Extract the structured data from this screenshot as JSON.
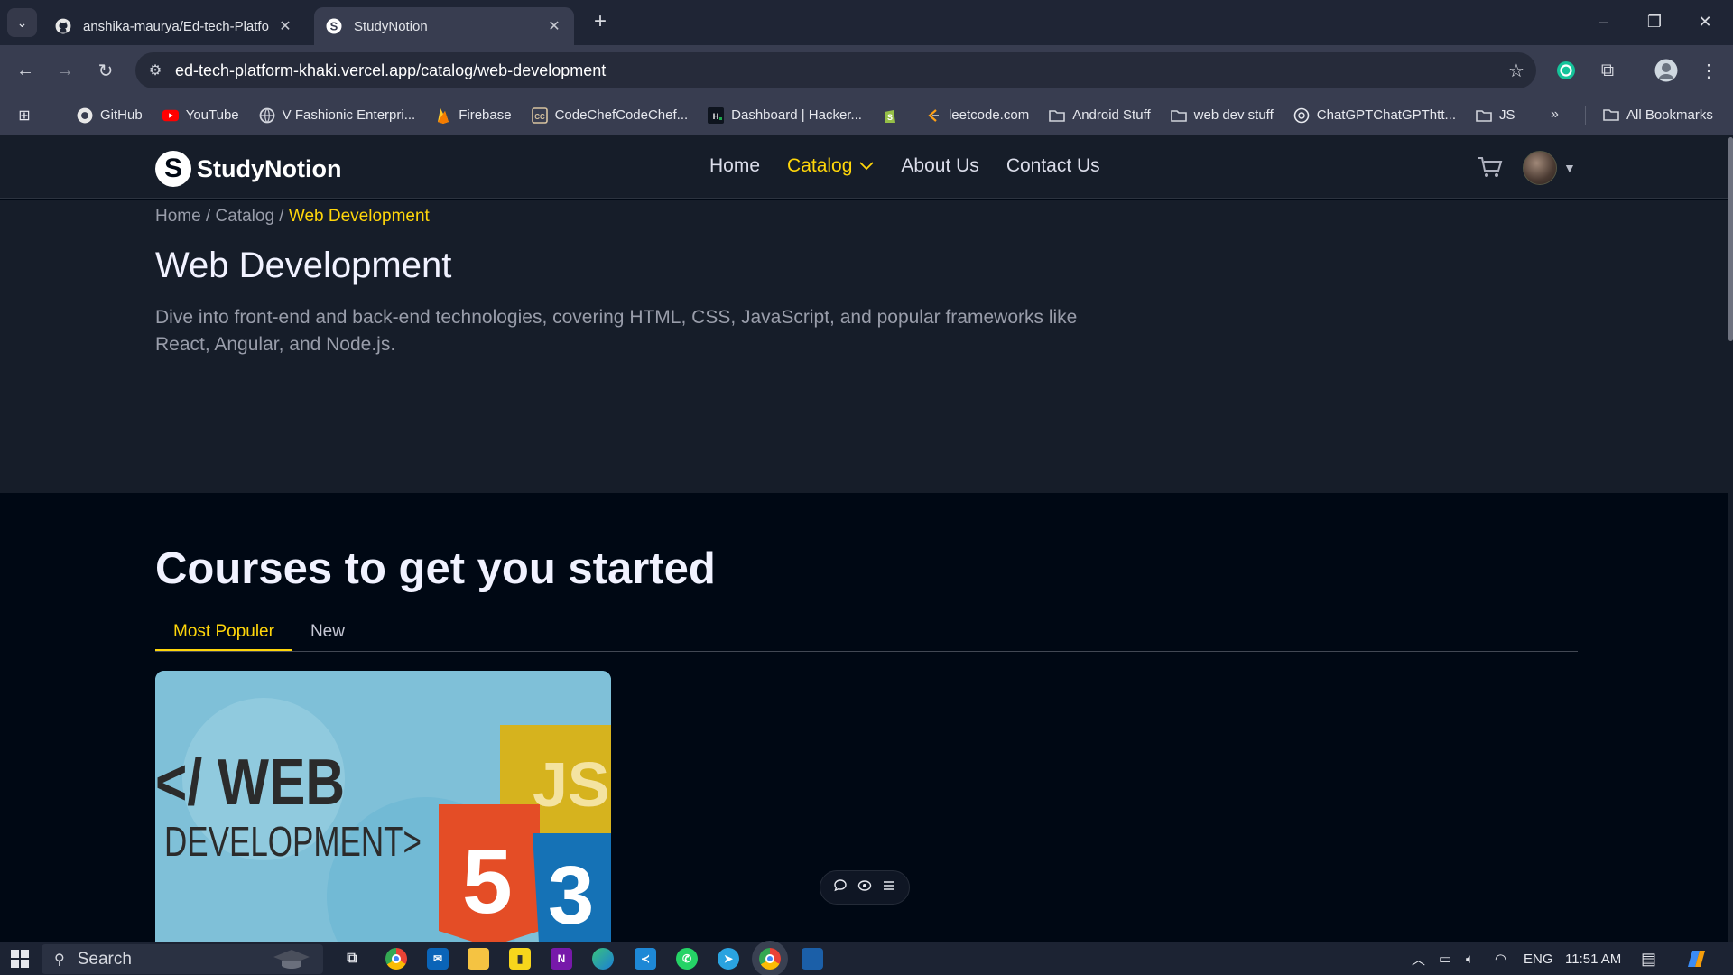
{
  "browser": {
    "tabs": [
      {
        "title": "anshika-maurya/Ed-tech-Platfo",
        "active": false,
        "favicon": "github-icon"
      },
      {
        "title": "StudyNotion",
        "active": true,
        "favicon": "studynotion-icon"
      }
    ],
    "url": "ed-tech-platform-khaki.vercel.app/catalog/web-development",
    "bookmarks": [
      {
        "label": "GitHub",
        "icon": "github-icon"
      },
      {
        "label": "YouTube",
        "icon": "youtube-icon"
      },
      {
        "label": "V Fashionic Enterpri...",
        "icon": "globe-icon"
      },
      {
        "label": "Firebase",
        "icon": "firebase-icon"
      },
      {
        "label": "CodeChefCodeChef...",
        "icon": "codechef-icon"
      },
      {
        "label": "Dashboard | Hacker...",
        "icon": "hackerrank-icon"
      },
      {
        "label": "",
        "icon": "shopify-icon"
      },
      {
        "label": "leetcode.com",
        "icon": "leetcode-icon"
      },
      {
        "label": "Android Stuff",
        "icon": "folder-icon"
      },
      {
        "label": "web dev stuff",
        "icon": "folder-icon"
      },
      {
        "label": "ChatGPTChatGPThtt...",
        "icon": "chatgpt-icon"
      },
      {
        "label": "JS",
        "icon": "folder-icon"
      }
    ],
    "all_bookmarks": "All Bookmarks"
  },
  "site": {
    "logo_letter": "S",
    "brand": "StudyNotion",
    "nav": {
      "home": "Home",
      "catalog": "Catalog",
      "about": "About Us",
      "contact": "Contact Us"
    },
    "accent": "#FFD60A"
  },
  "hero": {
    "crumb_home": "Home",
    "crumb_sep": " / ",
    "crumb_catalog": "Catalog",
    "crumb_current": "Web Development",
    "title": "Web Development",
    "description": "Dive into front-end and back-end technologies, covering HTML, CSS, JavaScript, and popular frameworks like React, Angular, and Node.js."
  },
  "courses": {
    "heading": "Courses to get you started",
    "tabs": [
      "Most Populer",
      "New"
    ],
    "card_image_text": {
      "line1": "</ WEB",
      "line2": "DEVELOPMENT>",
      "badge_html": "5",
      "badge_css": "3",
      "badge_js": "JS"
    }
  },
  "taskbar": {
    "search_label": "Search",
    "language": "ENG",
    "time": "11:51 AM"
  }
}
